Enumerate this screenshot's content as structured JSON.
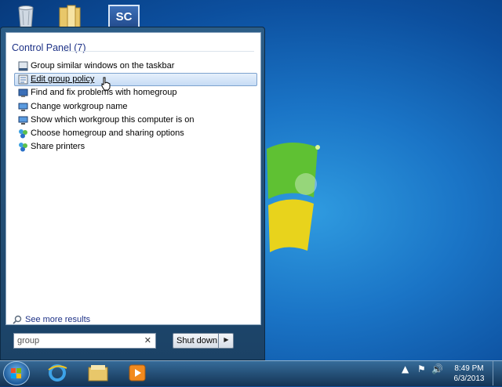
{
  "desktop": {
    "shortcut_label": "SC"
  },
  "start_menu": {
    "section_title": "Control Panel (7)",
    "results": [
      {
        "label": "Group similar windows on the taskbar",
        "icon": "taskbar-icon"
      },
      {
        "label": "Edit group policy",
        "icon": "policy-icon",
        "selected": true
      },
      {
        "label": "Find and fix problems with homegroup",
        "icon": "troubleshoot-icon"
      },
      {
        "label": "Change workgroup name",
        "icon": "computer-icon"
      },
      {
        "label": "Show which workgroup this computer is on",
        "icon": "computer-icon"
      },
      {
        "label": "Choose homegroup and sharing options",
        "icon": "homegroup-icon"
      },
      {
        "label": "Share printers",
        "icon": "homegroup-icon"
      }
    ],
    "see_more": "See more results",
    "search": {
      "value": "group"
    },
    "shutdown_label": "Shut down"
  },
  "taskbar": {
    "clock_time": "8:49 PM",
    "clock_date": "6/3/2013"
  },
  "colors": {
    "accent": "#1e3287",
    "selection": "#c6dcf5"
  }
}
